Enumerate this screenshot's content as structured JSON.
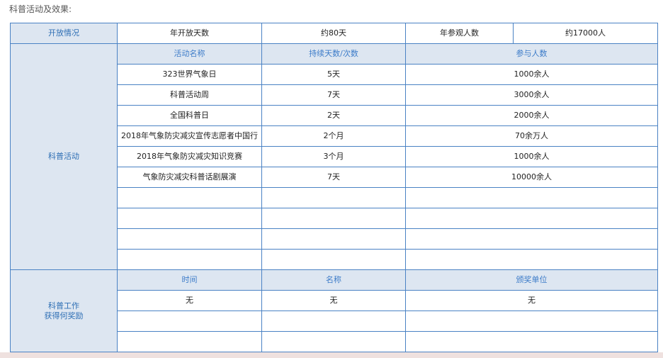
{
  "heading": "科普活动及效果:",
  "open_info": {
    "label": "开放情况",
    "open_days_label": "年开放天数",
    "open_days_value": "约80天",
    "visitors_label": "年参观人数",
    "visitors_value": "约17000人"
  },
  "activities": {
    "label": "科普活动",
    "headers": [
      "活动名称",
      "持续天数/次数",
      "参与人数"
    ],
    "rows": [
      [
        "323世界气象日",
        "5天",
        "1000余人"
      ],
      [
        "科普活动周",
        "7天",
        "3000余人"
      ],
      [
        "全国科普日",
        "2天",
        "2000余人"
      ],
      [
        "2018年气象防灾减灾宣传志愿者中国行",
        "2个月",
        "70余万人"
      ],
      [
        "2018年气象防灾减灾知识竞赛",
        "3个月",
        "1000余人"
      ],
      [
        "气象防灾减灾科普话剧展演",
        "7天",
        "10000余人"
      ],
      [
        "",
        "",
        ""
      ],
      [
        "",
        "",
        ""
      ],
      [
        "",
        "",
        ""
      ],
      [
        "",
        "",
        ""
      ]
    ]
  },
  "awards": {
    "label_line1": "科普工作",
    "label_line2": "获得何奖励",
    "headers": [
      "时间",
      "名称",
      "颁奖单位"
    ],
    "rows": [
      [
        "无",
        "无",
        "无"
      ],
      [
        "",
        "",
        ""
      ],
      [
        "",
        "",
        ""
      ]
    ]
  }
}
